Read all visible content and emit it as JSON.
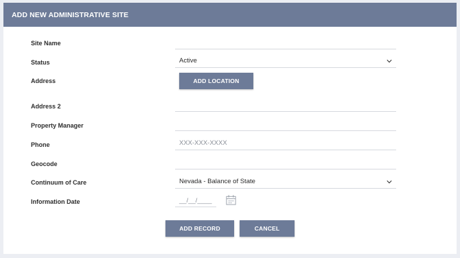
{
  "header": {
    "title": "ADD NEW ADMINISTRATIVE SITE"
  },
  "colors": {
    "header_bg": "#6d7b98",
    "button_bg": "#6d7b98",
    "page_bg": "#eceef3"
  },
  "form": {
    "site_name": {
      "label": "Site Name",
      "value": ""
    },
    "status": {
      "label": "Status",
      "value": "Active"
    },
    "address": {
      "label": "Address",
      "button": "ADD LOCATION"
    },
    "address2": {
      "label": "Address 2",
      "value": ""
    },
    "property_manager": {
      "label": "Property Manager",
      "value": ""
    },
    "phone": {
      "label": "Phone",
      "placeholder": "XXX-XXX-XXXX"
    },
    "geocode": {
      "label": "Geocode",
      "value": ""
    },
    "coc": {
      "label": "Continuum of Care",
      "value": "Nevada - Balance of State"
    },
    "info_date": {
      "label": "Information Date",
      "placeholder": "__/__/____",
      "icon": "calendar-icon"
    }
  },
  "actions": {
    "add_record": "ADD RECORD",
    "cancel": "CANCEL"
  }
}
